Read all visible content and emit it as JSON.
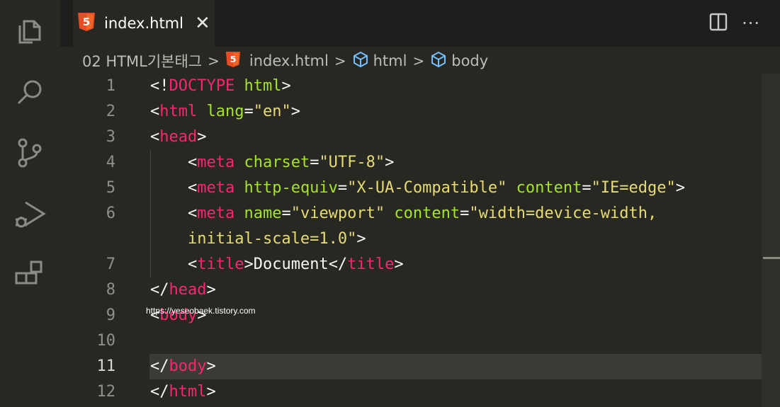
{
  "tab": {
    "label": "index.html",
    "close": "✕"
  },
  "tab_actions": {
    "more": "···"
  },
  "breadcrumb": {
    "folder": "02 HTML기본태그",
    "file": "index.html",
    "sym1": "html",
    "sym2": "body",
    "sep": ">"
  },
  "lines": [
    {
      "n": "1"
    },
    {
      "n": "2"
    },
    {
      "n": "3"
    },
    {
      "n": "4"
    },
    {
      "n": "5"
    },
    {
      "n": "6"
    },
    {
      "n": ""
    },
    {
      "n": "7"
    },
    {
      "n": "8"
    },
    {
      "n": "9"
    },
    {
      "n": "10"
    },
    {
      "n": "11"
    },
    {
      "n": "12"
    }
  ],
  "code": {
    "doctype": "DOCTYPE",
    "doctype_html": "html",
    "html": "html",
    "lang": "lang",
    "lang_val": "\"en\"",
    "head": "head",
    "meta": "meta",
    "charset": "charset",
    "charset_val": "\"UTF-8\"",
    "http_equiv": "http-equiv",
    "http_equiv_val": "\"X-UA-Compatible\"",
    "content": "content",
    "content_val1": "\"IE=edge\"",
    "name": "name",
    "name_val": "\"viewport\"",
    "content_val2_a": "\"width=device-width,",
    "content_val2_b": "initial-scale=1.0\"",
    "title": "title",
    "title_text": "Document",
    "body": "body"
  },
  "watermark": "https://yeseobaek.tistory.com",
  "colors": {
    "tag": "#f92672",
    "attr": "#a6e22e",
    "string": "#e6db74",
    "text": "#f8f8f2",
    "bg": "#272822"
  },
  "icons": [
    "explorer-icon",
    "search-icon",
    "source-control-icon",
    "run-debug-icon",
    "extensions-icon",
    "html5-icon",
    "symbol-cube-icon",
    "split-editor-icon",
    "more-actions-icon",
    "close-icon"
  ]
}
